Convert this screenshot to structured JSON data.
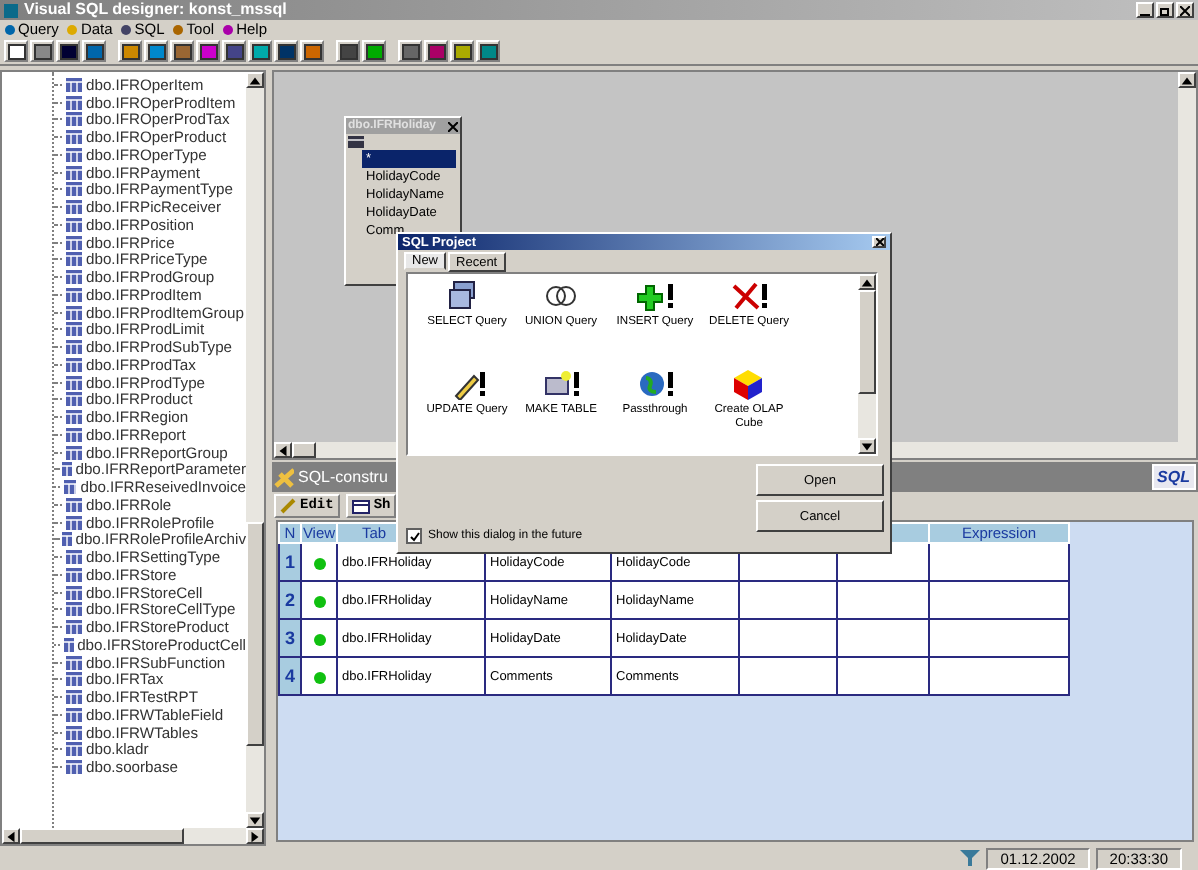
{
  "window": {
    "title": "Visual SQL designer: konst_mssql"
  },
  "menu": [
    {
      "label": "Query"
    },
    {
      "label": "Data"
    },
    {
      "label": "SQL"
    },
    {
      "label": "Tool"
    },
    {
      "label": "Help"
    }
  ],
  "tree": {
    "items": [
      "dbo.IFROperItem",
      "dbo.IFROperProdItem",
      "dbo.IFROperProdTax",
      "dbo.IFROperProduct",
      "dbo.IFROperType",
      "dbo.IFRPayment",
      "dbo.IFRPaymentType",
      "dbo.IFRPicReceiver",
      "dbo.IFRPosition",
      "dbo.IFRPrice",
      "dbo.IFRPriceType",
      "dbo.IFRProdGroup",
      "dbo.IFRProdItem",
      "dbo.IFRProdItemGroup",
      "dbo.IFRProdLimit",
      "dbo.IFRProdSubType",
      "dbo.IFRProdTax",
      "dbo.IFRProdType",
      "dbo.IFRProduct",
      "dbo.IFRRegion",
      "dbo.IFRReport",
      "dbo.IFRReportGroup",
      "dbo.IFRReportParameter",
      "dbo.IFRReseivedInvoice",
      "dbo.IFRRole",
      "dbo.IFRRoleProfile",
      "dbo.IFRRoleProfileArchiv",
      "dbo.IFRSettingType",
      "dbo.IFRStore",
      "dbo.IFRStoreCell",
      "dbo.IFRStoreCellType",
      "dbo.IFRStoreProduct",
      "dbo.IFRStoreProductCell",
      "dbo.IFRSubFunction",
      "dbo.IFRTax",
      "dbo.IFRTestRPT",
      "dbo.IFRWTableField",
      "dbo.IFRWTables",
      "dbo.kladr",
      "dbo.soorbase"
    ]
  },
  "canvas": {
    "table_window": {
      "title": "dbo.IFRHoliday",
      "fields": [
        {
          "name": "*",
          "selected": true
        },
        {
          "name": "HolidayCode",
          "selected": false
        },
        {
          "name": "HolidayName",
          "selected": false
        },
        {
          "name": "HolidayDate",
          "selected": false
        },
        {
          "name": "Comm",
          "selected": false
        }
      ]
    }
  },
  "constructor": {
    "title": "SQL-constru",
    "logo": "SQL",
    "tools": [
      {
        "label": "Edit"
      },
      {
        "label": "Sh"
      }
    ],
    "grid": {
      "columns": [
        "N",
        "View",
        "Tab",
        "",
        "",
        "",
        "",
        "Expression"
      ],
      "rows": [
        {
          "cells": [
            "1",
            "",
            "dbo.IFRHoliday",
            "HolidayCode",
            "HolidayCode",
            "",
            "",
            ""
          ]
        },
        {
          "cells": [
            "2",
            "",
            "dbo.IFRHoliday",
            "HolidayName",
            "HolidayName",
            "",
            "",
            ""
          ]
        },
        {
          "cells": [
            "3",
            "",
            "dbo.IFRHoliday",
            "HolidayDate",
            "HolidayDate",
            "",
            "",
            ""
          ]
        },
        {
          "cells": [
            "4",
            "",
            "dbo.IFRHoliday",
            "Comments",
            "Comments",
            "",
            "",
            ""
          ]
        }
      ]
    }
  },
  "dialog": {
    "title": "SQL Project",
    "tabs": [
      {
        "label": "New",
        "selected": true
      },
      {
        "label": "Recent",
        "selected": false
      }
    ],
    "items": [
      {
        "label": "SELECT Query"
      },
      {
        "label": "UNION Query"
      },
      {
        "label": "INSERT Query"
      },
      {
        "label": "DELETE Query"
      },
      {
        "label": "UPDATE Query"
      },
      {
        "label": "MAKE TABLE"
      },
      {
        "label": "Passthrough"
      },
      {
        "label": "Create OLAP Cube"
      }
    ],
    "buttons": [
      "Open",
      "Cancel"
    ],
    "checkbox": {
      "label": "Show this dialog in the future",
      "checked": true
    }
  },
  "status_bar": {
    "date": "01.12.2002",
    "time": "20:33:30"
  }
}
